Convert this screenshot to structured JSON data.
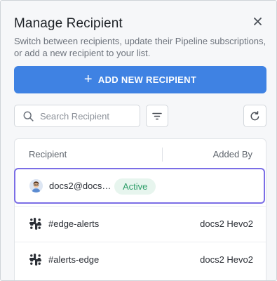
{
  "dialog": {
    "title": "Manage Recipient",
    "subtitle": "Switch between recipients, update their Pipeline subscriptions, or add a new recipient to your list.",
    "close_icon": "close-icon"
  },
  "add_button": {
    "label": "ADD NEW RECIPIENT",
    "icon": "plus-icon"
  },
  "search": {
    "placeholder": "Search Recipient",
    "value": "",
    "icon": "search-icon"
  },
  "toolbar": {
    "filter_icon": "filter-icon",
    "refresh_icon": "refresh-icon"
  },
  "table": {
    "columns": [
      "Recipient",
      "Added By"
    ],
    "rows": [
      {
        "recipient": "docs2@docs…",
        "type": "email",
        "icon": "user-avatar-icon",
        "status": "Active",
        "added_by": "",
        "selected": true
      },
      {
        "recipient": "#edge-alerts",
        "type": "slack",
        "icon": "slack-icon",
        "status": "",
        "added_by": "docs2 Hevo2",
        "selected": false
      },
      {
        "recipient": "#alerts-edge",
        "type": "slack",
        "icon": "slack-icon",
        "status": "",
        "added_by": "docs2 Hevo2",
        "selected": false
      }
    ]
  },
  "colors": {
    "accent": "#3f82e3",
    "selected_border": "#7b6ee6",
    "active_badge_bg": "#e7f5ee",
    "active_badge_text": "#2f9e6a"
  }
}
